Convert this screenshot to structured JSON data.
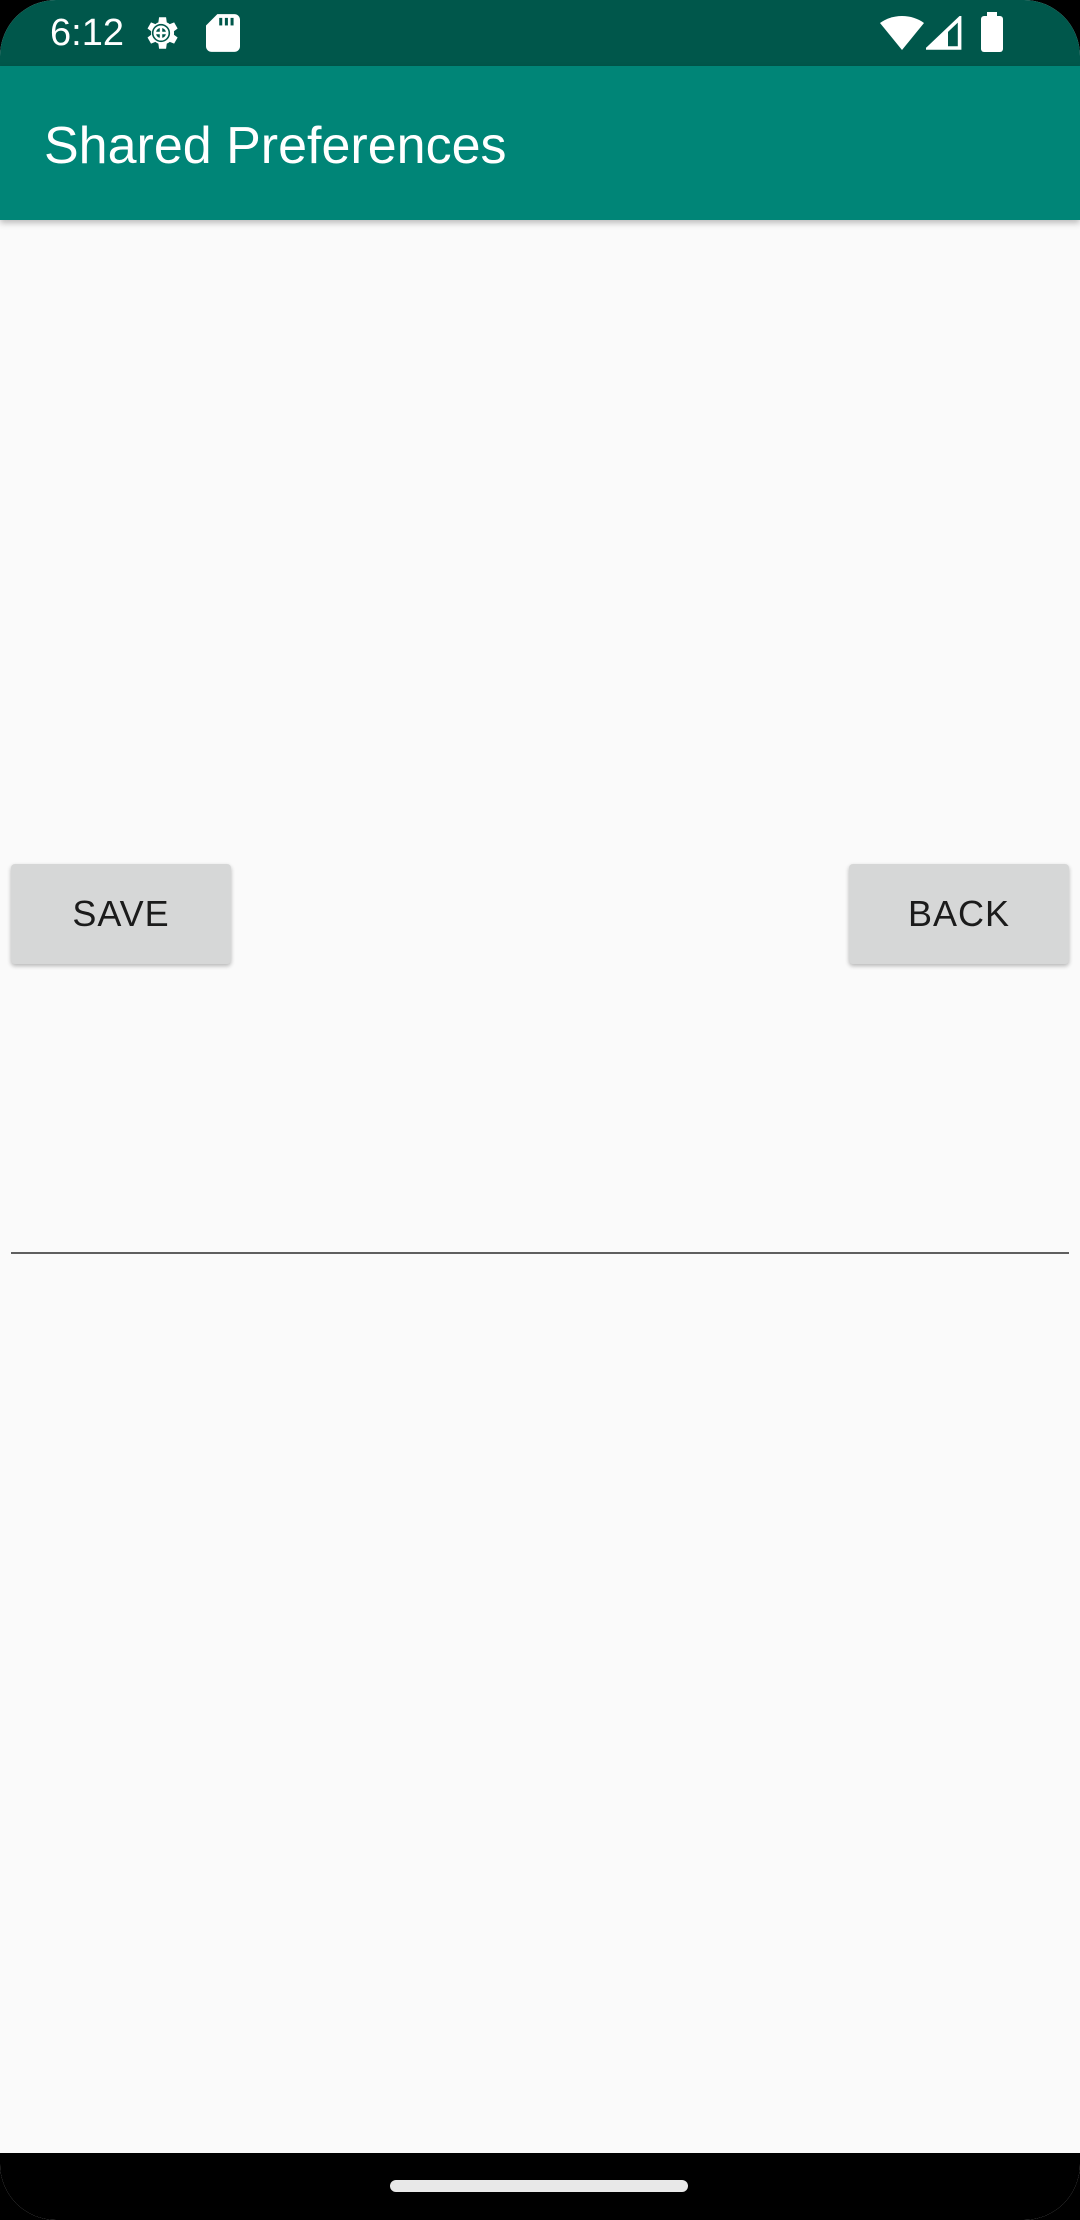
{
  "status_bar": {
    "time": "6:12",
    "icons": [
      "settings-gear-icon",
      "sd-card-icon",
      "wifi-icon",
      "cell-signal-icon",
      "battery-icon"
    ],
    "background_color": "#00574b"
  },
  "app_bar": {
    "title": "Shared Preferences",
    "background_color": "#008577"
  },
  "main": {
    "save_label": "SAVE",
    "back_label": "BACK",
    "text_field_value": "",
    "text_field_placeholder": ""
  },
  "nav_bar": {
    "home_indicator": "home-gesture-pill"
  }
}
